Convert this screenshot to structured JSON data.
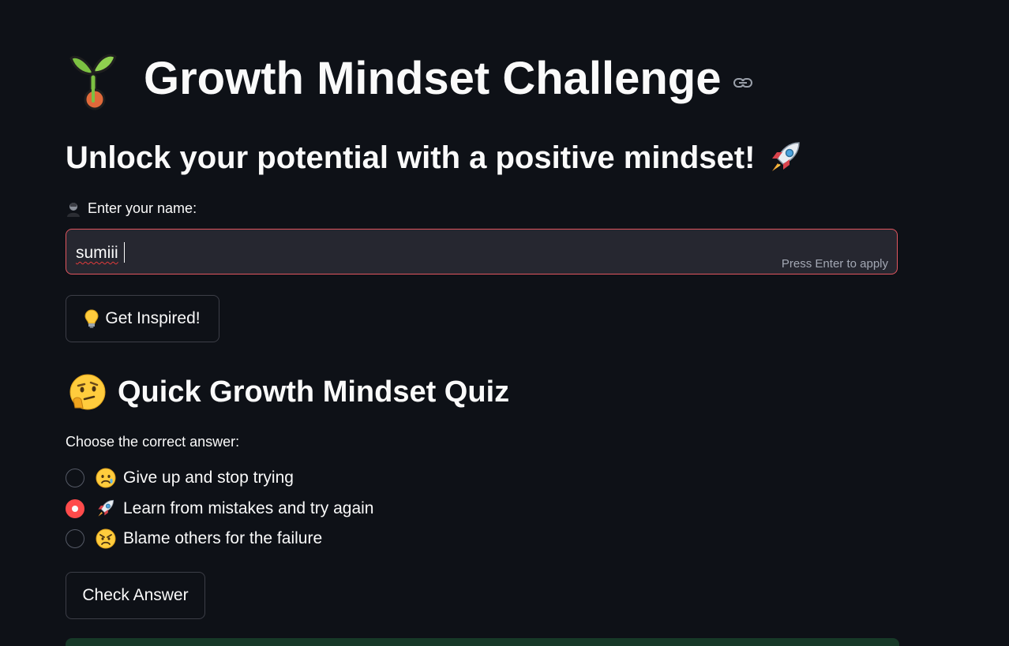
{
  "header": {
    "title": "Growth Mindset Challenge",
    "title_icon": "seedling-icon",
    "anchor_icon": "link-icon"
  },
  "subtitle": {
    "text": "Unlock your potential with a positive mindset!",
    "icon": "rocket-icon"
  },
  "name_field": {
    "label": "Enter your name:",
    "label_icon": "person-icon",
    "value": "sumiii",
    "hint": "Press Enter to apply"
  },
  "inspire_button": {
    "label": "Get Inspired!",
    "icon": "lightbulb-icon"
  },
  "quiz": {
    "heading": "Quick Growth Mindset Quiz",
    "heading_icon": "thinking-face-icon",
    "prompt": "Choose the correct answer:",
    "options": [
      {
        "label": "Give up and stop trying",
        "icon": "crying-face-icon",
        "selected": false
      },
      {
        "label": "Learn from mistakes and try again",
        "icon": "rocket-icon",
        "selected": true
      },
      {
        "label": "Blame others for the failure",
        "icon": "angry-face-icon",
        "selected": false
      }
    ],
    "check_button": "Check Answer"
  },
  "colors": {
    "background": "#0e1117",
    "accent": "#ff4b4b",
    "input_bg": "#262730",
    "success_bg": "#173928"
  }
}
